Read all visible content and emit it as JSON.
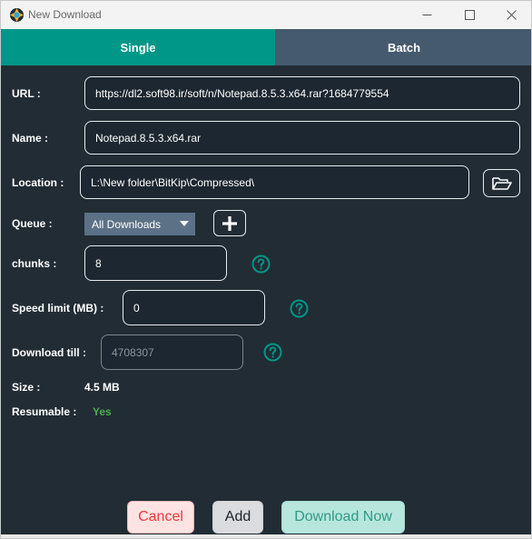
{
  "window": {
    "title": "New Download",
    "controls": {
      "minimize": "minimize",
      "maximize": "maximize",
      "close": "close"
    }
  },
  "tabs": [
    {
      "label": "Single",
      "active": true
    },
    {
      "label": "Batch",
      "active": false
    }
  ],
  "form": {
    "url_label": "URL :",
    "url_value": "https://dl2.soft98.ir/soft/n/Notepad.8.5.3.x64.rar?1684779554",
    "name_label": "Name :",
    "name_value": "Notepad.8.5.3.x64.rar",
    "location_label": "Location :",
    "location_value": "L:\\New folder\\BitKip\\Compressed\\",
    "queue_label": "Queue :",
    "queue_selected": "All Downloads",
    "chunks_label": "chunks :",
    "chunks_value": "8",
    "speed_label": "Speed limit (MB) :",
    "speed_value": "0",
    "till_label": "Download till :",
    "till_placeholder": "4708307",
    "size_label": "Size :",
    "size_value": "4.5 MB",
    "resumable_label": "Resumable :",
    "resumable_value": "Yes"
  },
  "buttons": {
    "cancel": "Cancel",
    "add": "Add",
    "download_now": "Download Now"
  },
  "colors": {
    "accent": "#009688",
    "tab_inactive": "#455a6e",
    "background": "#222c34",
    "resumable_yes": "#4caf50",
    "help_icon": "#009688"
  }
}
